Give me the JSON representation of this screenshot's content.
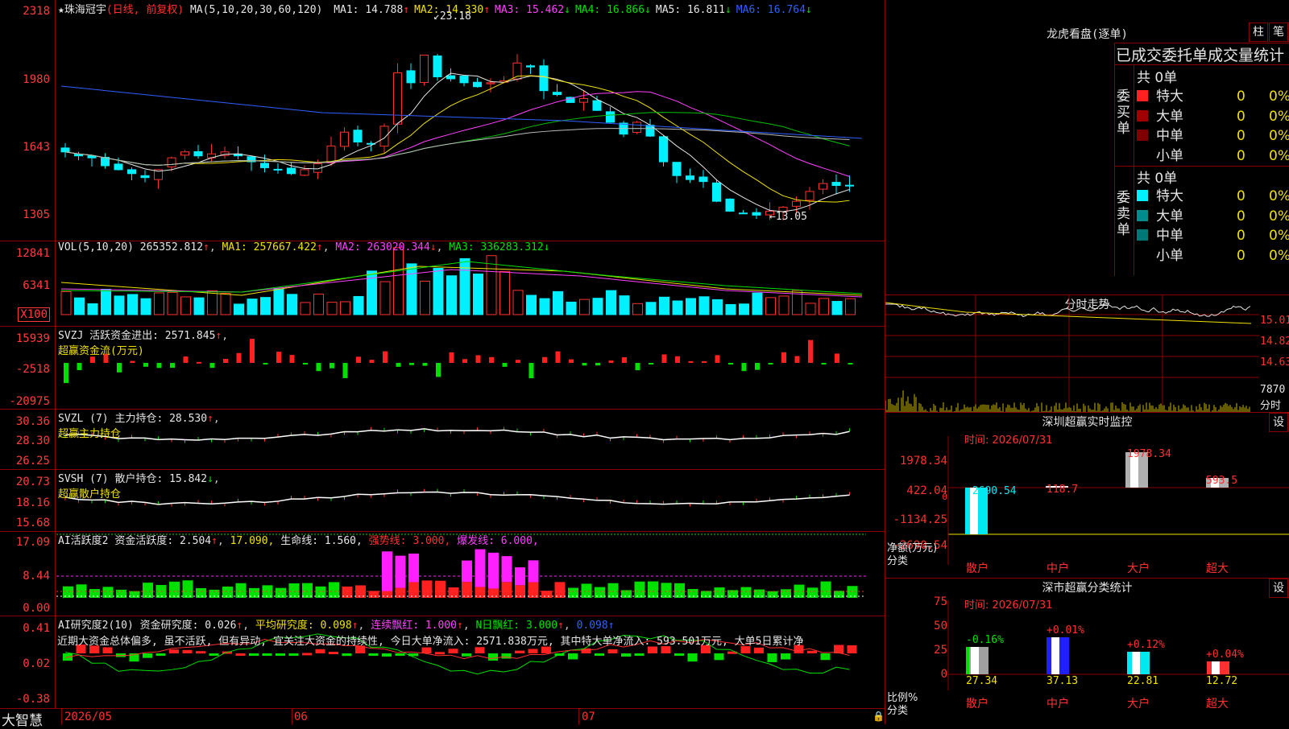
{
  "stock": {
    "name": "珠海冠宇",
    "mode": "(日线, 前复权)",
    "ma_label": "MA(5,10,20,30,60,120)",
    "ma": [
      {
        "label": "MA1:",
        "value": "14.788",
        "arrow": "↑",
        "color": "#e6e6e6"
      },
      {
        "label": "MA2:",
        "value": "14.330",
        "arrow": "↑",
        "color": "#f0e000"
      },
      {
        "label": "MA3:",
        "value": "15.462",
        "arrow": "↓",
        "color": "#ff40ff"
      },
      {
        "label": "MA4:",
        "value": "16.866",
        "arrow": "↓",
        "color": "#00e000"
      },
      {
        "label": "MA5:",
        "value": "16.811",
        "arrow": "↓",
        "color": "#e6e6e6"
      },
      {
        "label": "MA6:",
        "value": "16.764",
        "arrow": "↓",
        "color": "#3060ff"
      }
    ],
    "y_labels": [
      "2318",
      "1980",
      "1643",
      "1305"
    ],
    "high_mark": "23.18",
    "low_mark": "←13.05"
  },
  "volume": {
    "title": "VOL(5,10,20)",
    "value": "265352.812",
    "ma1": "MA1: 257667.422",
    "ma2": "MA2: 263020.344",
    "ma3": "MA3: 336283.312",
    "y_labels": [
      "12841",
      "6341"
    ],
    "unit": "X100"
  },
  "svzj": {
    "title": "SVZJ",
    "line": "活跃资金进出: 2571.845",
    "sub": "超赢资金流(万元)",
    "y_labels": [
      "15939",
      "-2518",
      "-20975"
    ]
  },
  "svzl": {
    "title": "SVZL (7)",
    "line": "主力持仓: 28.530",
    "sub": "超赢主力持仓",
    "y_labels": [
      "30.36",
      "28.30",
      "26.25"
    ]
  },
  "svsh": {
    "title": "SVSH (7)",
    "line": "散户持仓: 15.842",
    "sub": "超赢散户持仓",
    "y_labels": [
      "20.73",
      "18.16",
      "15.68"
    ]
  },
  "ai_active": {
    "title": "AI活跃度2",
    "line1": "资金活跃度: 2.504",
    "v2": "17.090,",
    "life": "生命线: 1.560,",
    "strong": "强势线: 3.000,",
    "burst": "爆发线: 6.000,",
    "y_labels": [
      "17.09",
      "8.44",
      "0.00"
    ]
  },
  "ai_research": {
    "title": "AI研究度2(10)",
    "line1": "资金研究度: 0.026",
    "avg": "平均研究度: 0.098",
    "cont": "连续飘红: 1.000",
    "nday": "N日飘红: 3.000",
    "v": "0.098",
    "text": "近期大资金总体偏多, 虽不活跃, 但有异动, 宜关注大资金的持续性, 今日大单净流入: 2571.838万元, 其中特大单净流入: 593.501万元, 大单5日累计净",
    "y_labels": [
      "0.41",
      "0.02",
      "-0.38"
    ]
  },
  "xaxis": {
    "logo": "大智慧",
    "labels": [
      "2026/05",
      "06",
      "07"
    ]
  },
  "dragon": {
    "title": "龙虎看盘(逐单)",
    "btn1": "柱",
    "btn2": "笔",
    "subtitle": "已成交委托单成交量统计",
    "buy_label": "委买单",
    "sell_label": "委卖单",
    "buy_total": "共 0单",
    "sell_total": "共 0单",
    "buy_rows": [
      {
        "name": "特大",
        "color": "#ff2020",
        "count": "0",
        "pct": "0%"
      },
      {
        "name": "大单",
        "color": "#a00000",
        "count": "0",
        "pct": "0%"
      },
      {
        "name": "中单",
        "color": "#800000",
        "count": "0",
        "pct": "0%"
      },
      {
        "name": "小单",
        "color": "#000000",
        "count": "0",
        "pct": "0%"
      }
    ],
    "sell_rows": [
      {
        "name": "特大",
        "color": "#00f0ff",
        "count": "0",
        "pct": "0%"
      },
      {
        "name": "大单",
        "color": "#008c8c",
        "count": "0",
        "pct": "0%"
      },
      {
        "name": "中单",
        "color": "#007878",
        "count": "0",
        "pct": "0%"
      },
      {
        "name": "小单",
        "color": "#000000",
        "count": "0",
        "pct": "0%"
      }
    ]
  },
  "intraday": {
    "title": "分时走势",
    "y_labels": [
      "15.01",
      "14.82",
      "14.63"
    ],
    "vol_label": "7870",
    "vol_unit": "分时"
  },
  "sz_monitor": {
    "title": "深圳超赢实时监控",
    "btn": "设",
    "time": "时间: 2026/07/31",
    "y_labels": [
      "1978.34",
      "422.04",
      "0",
      "-1134.25",
      "-2690.54"
    ],
    "unit1": "净额(万元)",
    "unit2": "分类",
    "cats": [
      "散户",
      "中户",
      "大户",
      "超大"
    ],
    "vals": [
      "-2690.54",
      "118.7",
      "1978.34",
      "593.5"
    ]
  },
  "sz_class": {
    "title": "深市超赢分类统计",
    "btn": "设",
    "time": "时间: 2026/07/31",
    "y_labels": [
      "75",
      "50",
      "25",
      "0"
    ],
    "unit1": "比例%",
    "unit2": "分类",
    "cats": [
      "散户",
      "中户",
      "大户",
      "超大"
    ],
    "vals": [
      "27.34",
      "37.13",
      "22.81",
      "12.72"
    ],
    "deltas": [
      "-0.16%",
      "+0.01%",
      "+0.12%",
      "+0.04%"
    ]
  }
}
